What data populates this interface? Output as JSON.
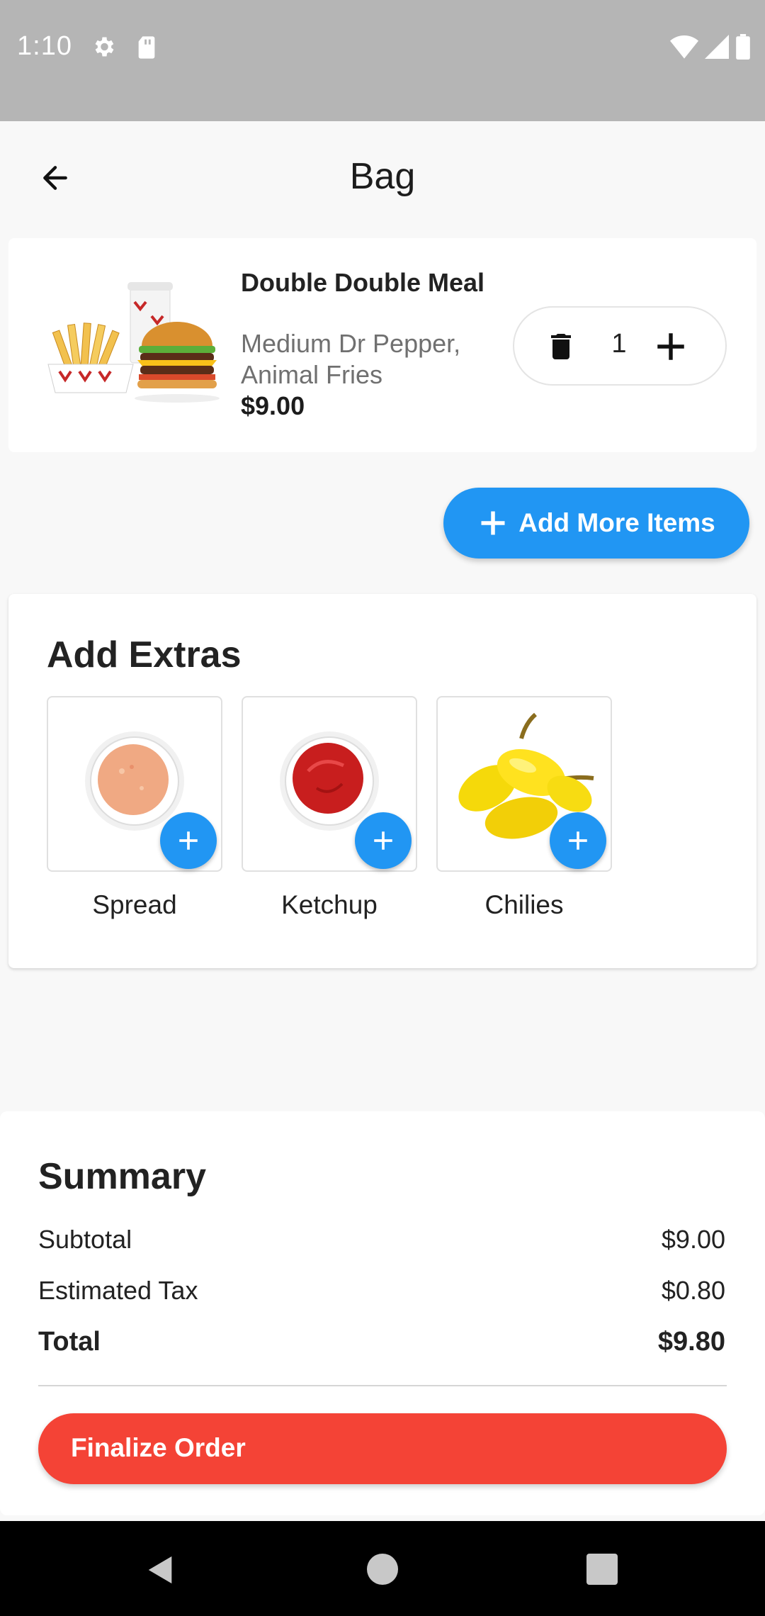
{
  "status_bar": {
    "time": "1:10",
    "icons": [
      "gear-icon",
      "sd-card-icon",
      "wifi-icon",
      "signal-icon",
      "battery-icon"
    ],
    "background": "#b5b5b5"
  },
  "app_bar": {
    "title": "Bag",
    "back_icon": "arrow-back-icon"
  },
  "cart": {
    "items": [
      {
        "name": "Double Double Meal",
        "desc_line1": "Medium Dr Pepper,",
        "desc_line2": "Animal Fries",
        "price": "$9.00",
        "quantity": "1",
        "image": "burger-meal-image"
      }
    ],
    "add_more_label": "Add More Items"
  },
  "extras": {
    "title": "Add Extras",
    "items": [
      {
        "label": "Spread",
        "image": "spread-sauce-cup-image"
      },
      {
        "label": "Ketchup",
        "image": "ketchup-cup-image"
      },
      {
        "label": "Chilies",
        "image": "yellow-chilies-image"
      }
    ]
  },
  "summary": {
    "title": "Summary",
    "subtotal_label": "Subtotal",
    "subtotal_value": "$9.00",
    "tax_label": "Estimated Tax",
    "tax_value": "$0.80",
    "total_label": "Total",
    "total_value": "$9.80",
    "finalize_label": "Finalize Order"
  },
  "colors": {
    "accent_blue": "#2196f3",
    "finalize_red": "#f44336",
    "background": "#f8f8f8"
  },
  "nav_bar": {
    "icons": [
      "nav-back-icon",
      "nav-home-icon",
      "nav-recents-icon"
    ]
  }
}
